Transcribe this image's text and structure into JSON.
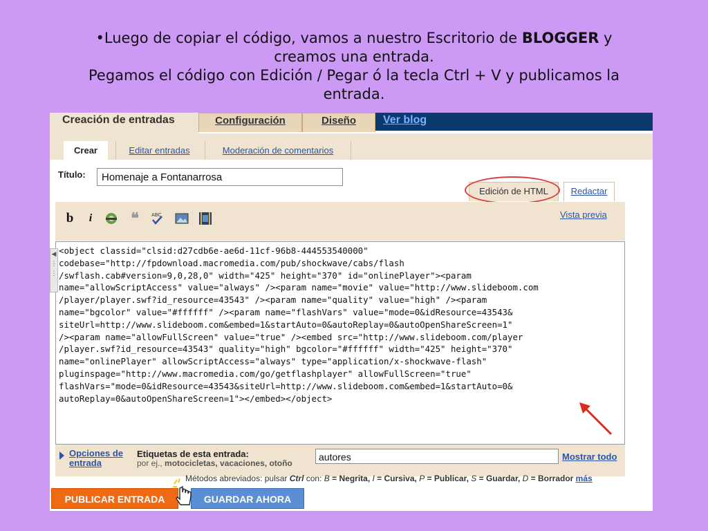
{
  "caption": {
    "line1_prefix": "•Luego de copiar el código, vamos a nuestro Escritorio de ",
    "line1_bold": "BLOGGER",
    "line1_suffix": " y",
    "line2": "creamos una entrada.",
    "line3": "Pegamos el código con Edición / Pegar ó la tecla Ctrl + V y publicamos la",
    "line4": "entrada."
  },
  "main_tabs": [
    "Creación de entradas",
    "Configuración",
    "Diseño",
    "Ver blog"
  ],
  "sub_tabs": [
    "Crear",
    "Editar entradas",
    "Moderación de comentarios"
  ],
  "post": {
    "title_label": "Título:",
    "title_value": "Homenaje a Fontanarrosa"
  },
  "editor_modes": {
    "html": "Edición de HTML",
    "compose": "Redactar"
  },
  "toolbar": {
    "bold_glyph": "b",
    "italic_glyph": "i",
    "quote_glyph": "❝",
    "spell_glyph": "ABC",
    "preview_label": "Vista previa"
  },
  "editor": {
    "code": "<object classid=\"clsid:d27cdb6e-ae6d-11cf-96b8-444553540000\"\ncodebase=\"http://fpdownload.macromedia.com/pub/shockwave/cabs/flash\n/swflash.cab#version=9,0,28,0\" width=\"425\" height=\"370\" id=\"onlinePlayer\"><param\nname=\"allowScriptAccess\" value=\"always\" /><param name=\"movie\" value=\"http://www.slideboom.com\n/player/player.swf?id_resource=43543\" /><param name=\"quality\" value=\"high\" /><param\nname=\"bgcolor\" value=\"#ffffff\" /><param name=\"flashVars\" value=\"mode=0&idResource=43543&\nsiteUrl=http://www.slideboom.com&embed=1&startAuto=0&autoReplay=0&autoOpenShareScreen=1\"\n/><param name=\"allowFullScreen\" value=\"true\" /><embed src=\"http://www.slideboom.com/player\n/player.swf?id_resource=43543\" quality=\"high\" bgcolor=\"#ffffff\" width=\"425\" height=\"370\"\nname=\"onlinePlayer\" allowScriptAccess=\"always\" type=\"application/x-shockwave-flash\"\npluginspage=\"http://www.macromedia.com/go/getflashplayer\" allowFullScreen=\"true\"\nflashVars=\"mode=0&idResource=43543&siteUrl=http://www.slideboom.com&embed=1&startAuto=0&\nautoReplay=0&autoOpenShareScreen=1\"></embed></object>"
  },
  "post_options": {
    "options_line1": "Opciones de",
    "options_line2": "entrada",
    "labels_title": "Etiquetas de esta entrada:",
    "labels_hint_prefix": "por ej., ",
    "labels_hint_bold": "motocicletas, vacaciones, otoño",
    "labels_value": "autores",
    "show_all": "Mostrar todo"
  },
  "shortcuts": {
    "prefix": "Métodos abreviados: pulsar ",
    "ctrl": "Ctrl",
    "con": " con: ",
    "b_key": "B",
    "b_action": " = Negrita, ",
    "i_key": "I",
    "i_action": " = Cursiva, ",
    "p_key": "P",
    "p_action": " = Publicar, ",
    "s_key": "S",
    "s_action": " = Guardar, ",
    "d_key": "D",
    "d_action": " = Borrador ",
    "more": "más"
  },
  "buttons": {
    "publish": "PUBLICAR ENTRADA",
    "save": "GUARDAR AHORA"
  },
  "colors": {
    "slide_bg": "#cc99f5",
    "nav_navy": "#0b3a6e",
    "publish_orange": "#f06a14",
    "save_blue": "#5a8fd6",
    "link_blue": "#2b54a8",
    "annotation_red": "#d83c3c"
  }
}
